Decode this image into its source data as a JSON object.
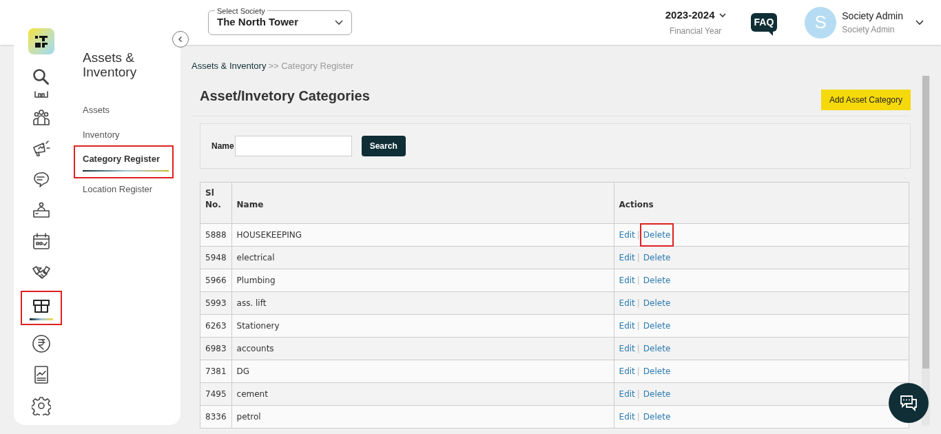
{
  "rail": {
    "items": [
      {
        "kind": "search",
        "selected": false,
        "highlighted": false
      },
      {
        "kind": "building",
        "selected": false,
        "highlighted": false
      },
      {
        "kind": "people",
        "selected": false,
        "highlighted": false
      },
      {
        "kind": "megaphone",
        "selected": false,
        "highlighted": false
      },
      {
        "kind": "chat",
        "selected": false,
        "highlighted": false
      },
      {
        "kind": "desk",
        "selected": false,
        "highlighted": false
      },
      {
        "kind": "calendar",
        "selected": false,
        "highlighted": false
      },
      {
        "kind": "handshake",
        "selected": false,
        "highlighted": false
      },
      {
        "kind": "box",
        "selected": true,
        "highlighted": true
      },
      {
        "kind": "rupee",
        "selected": false,
        "highlighted": false
      },
      {
        "kind": "report",
        "selected": false,
        "highlighted": false
      },
      {
        "kind": "settings",
        "selected": false,
        "highlighted": false
      }
    ]
  },
  "submenu": {
    "title": "Assets & Inventory",
    "items": [
      {
        "label": "Assets",
        "selected": false,
        "highlighted": false
      },
      {
        "label": "Inventory",
        "selected": false,
        "highlighted": false
      },
      {
        "label": "Category Register",
        "selected": true,
        "highlighted": true
      },
      {
        "label": "Location Register",
        "selected": false,
        "highlighted": false
      }
    ]
  },
  "header": {
    "society_label": "Select Society",
    "society": "The North Tower",
    "year": "2023-2024",
    "year_caption": "Financial Year",
    "faq": "FAQ",
    "avatar_letter": "S",
    "user_name": "Society Admin",
    "user_role": "Society Admin"
  },
  "breadcrumb": {
    "parent": "Assets & Inventory",
    "current": ">> Category Register"
  },
  "page_title": "Asset/Invetory Categories",
  "add_button": "Add Asset Category",
  "filter": {
    "label": "Name",
    "button": "Search"
  },
  "table": {
    "columns": [
      "Sl No.",
      "Name",
      "Actions"
    ],
    "rows": [
      {
        "sl": "5888",
        "name": "HOUSEKEEPING",
        "edit": "Edit",
        "separator": "|",
        "delete": "Delete",
        "highlighted": true
      },
      {
        "sl": "5948",
        "name": "electrical",
        "edit": "Edit",
        "separator": "|",
        "delete": "Delete",
        "highlighted": false
      },
      {
        "sl": "5966",
        "name": "Plumbing",
        "edit": "Edit",
        "separator": "|",
        "delete": "Delete",
        "highlighted": false
      },
      {
        "sl": "5993",
        "name": "ass. lift",
        "edit": "Edit",
        "separator": "|",
        "delete": "Delete",
        "highlighted": false
      },
      {
        "sl": "6263",
        "name": "Stationery",
        "edit": "Edit",
        "separator": "|",
        "delete": "Delete",
        "highlighted": false
      },
      {
        "sl": "6983",
        "name": "accounts",
        "edit": "Edit",
        "separator": "|",
        "delete": "Delete",
        "highlighted": false
      },
      {
        "sl": "7381",
        "name": "DG",
        "edit": "Edit",
        "separator": "|",
        "delete": "Delete",
        "highlighted": false
      },
      {
        "sl": "7495",
        "name": "cement",
        "edit": "Edit",
        "separator": "|",
        "delete": "Delete",
        "highlighted": false
      },
      {
        "sl": "8336",
        "name": "petrol",
        "edit": "Edit",
        "separator": "|",
        "delete": "Delete",
        "highlighted": false
      }
    ]
  }
}
